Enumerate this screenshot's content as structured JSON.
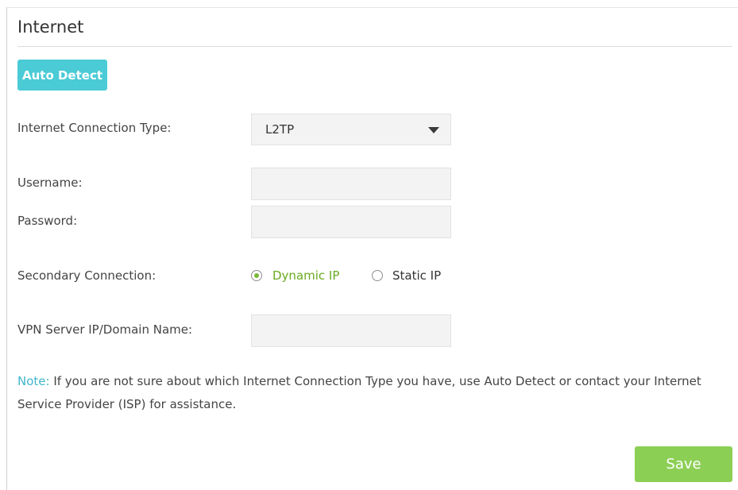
{
  "section": {
    "title": "Internet"
  },
  "auto_detect": {
    "label": "Auto Detect"
  },
  "connection_type": {
    "label": "Internet Connection Type:",
    "selected": "L2TP"
  },
  "username": {
    "label": "Username:",
    "value": ""
  },
  "password": {
    "label": "Password:",
    "value": ""
  },
  "secondary_connection": {
    "label": "Secondary Connection:",
    "options": [
      {
        "label": "Dynamic IP",
        "checked": true
      },
      {
        "label": "Static IP",
        "checked": false
      }
    ]
  },
  "vpn_server": {
    "label": "VPN Server IP/Domain Name:",
    "value": ""
  },
  "note": {
    "label": "Note:",
    "text": " If you are not sure about which Internet Connection Type you have, use Auto Detect or contact your Internet Service Provider (ISP) for assistance."
  },
  "save": {
    "label": "Save"
  },
  "colors": {
    "accent_teal": "#4acbd6",
    "save_green": "#8ccf55",
    "radio_active": "#6aaa22",
    "note_label": "#3fb6c9"
  },
  "icons": {
    "dropdown": "caret-down-icon",
    "radio_on": "radio-checked-icon",
    "radio_off": "radio-unchecked-icon"
  }
}
